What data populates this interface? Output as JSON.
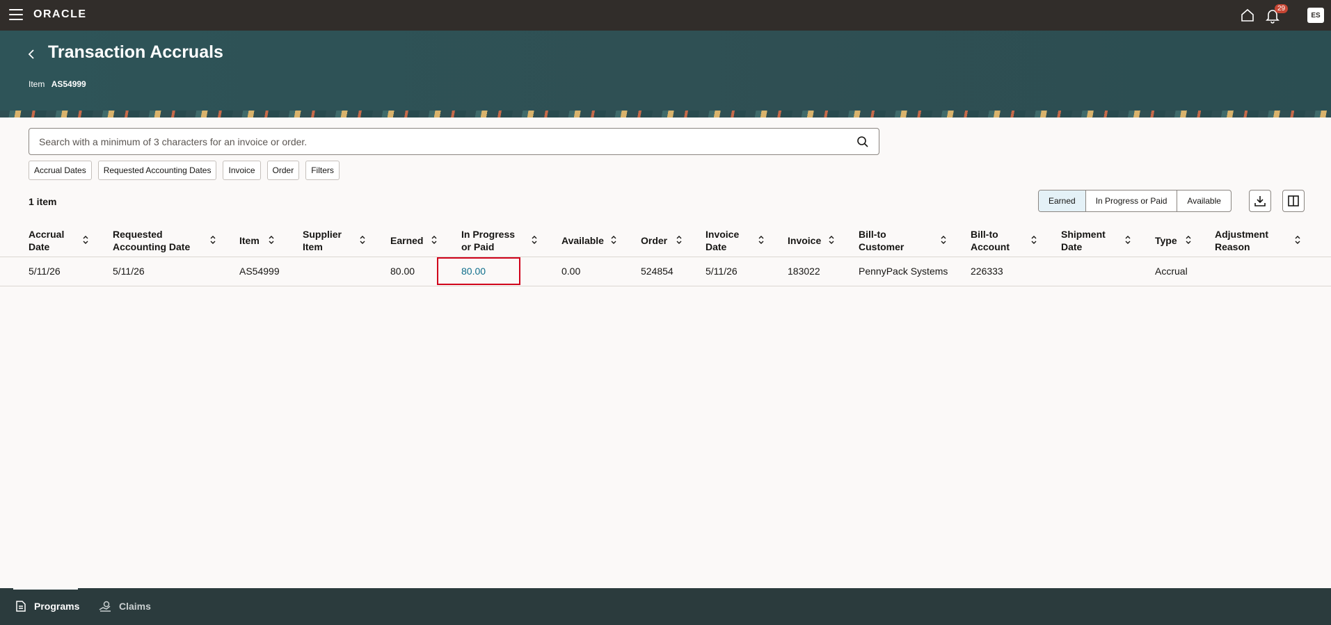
{
  "topbar": {
    "brand": "ORACLE",
    "notification_count": "29",
    "avatar_initials": "ES"
  },
  "header": {
    "title": "Transaction Accruals",
    "item_label": "Item",
    "item_value": "AS54999"
  },
  "search": {
    "placeholder": "Search with a minimum of 3 characters for an invoice or order."
  },
  "filters": [
    "Accrual Dates",
    "Requested Accounting Dates",
    "Invoice",
    "Order",
    "Filters"
  ],
  "results": {
    "count": "1 item"
  },
  "view_toggle": {
    "options": [
      "Earned",
      "In Progress or Paid",
      "Available"
    ],
    "selected": "Earned"
  },
  "table": {
    "columns": [
      "Accrual Date",
      "Requested Accounting Date",
      "Item",
      "Supplier Item",
      "Earned",
      "In Progress or Paid",
      "Available",
      "Order",
      "Invoice Date",
      "Invoice",
      "Bill-to Customer",
      "Bill-to Account",
      "Shipment Date",
      "Type",
      "Adjustment Reason"
    ],
    "rows": [
      [
        "5/11/26",
        "5/11/26",
        "AS54999",
        "",
        "80.00",
        "80.00",
        "0.00",
        "524854",
        "5/11/26",
        "183022",
        "PennyPack Systems",
        "226333",
        "",
        "Accrual",
        ""
      ]
    ]
  },
  "footer": {
    "items": [
      "Programs",
      "Claims"
    ],
    "active": "Programs"
  },
  "colors": {
    "topbar": "#312d2a",
    "header": "#2f4f53",
    "link": "#0e6e8b",
    "highlight": "#d0021b",
    "footer": "#2b3b3d"
  }
}
